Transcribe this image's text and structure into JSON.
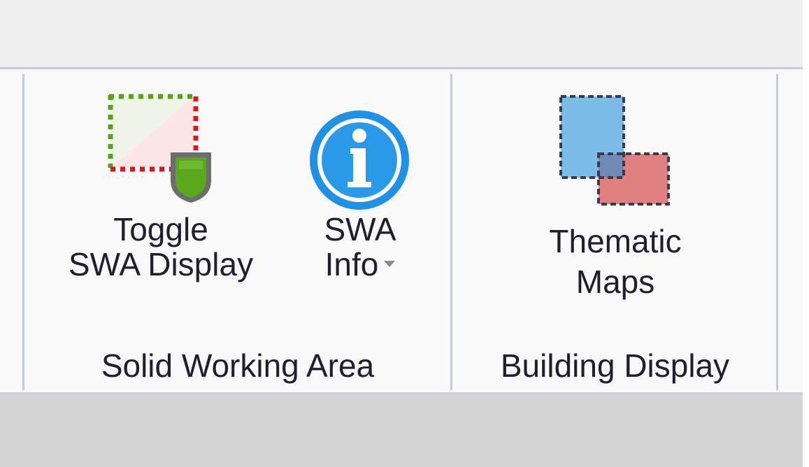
{
  "ribbon": {
    "groups": [
      {
        "label": "Solid Working Area",
        "buttons": [
          {
            "line1": "Toggle",
            "line2": "SWA Display",
            "icon": "toggle-swa-display-icon"
          },
          {
            "line1": "SWA",
            "line2": "Info",
            "icon": "info-icon",
            "has_dropdown": true
          }
        ]
      },
      {
        "label": "Building Display",
        "buttons": [
          {
            "line1": "Thematic",
            "line2": "Maps",
            "icon": "thematic-maps-icon"
          }
        ]
      }
    ]
  },
  "colors": {
    "info_blue": "#1e90e6",
    "shield_green": "#5aa81e",
    "dots_green": "#5a9e1e",
    "dots_red": "#cc1f1f",
    "map_blue": "#7bbde8",
    "map_red": "#e08080",
    "overlap": "#6f8ab4"
  }
}
